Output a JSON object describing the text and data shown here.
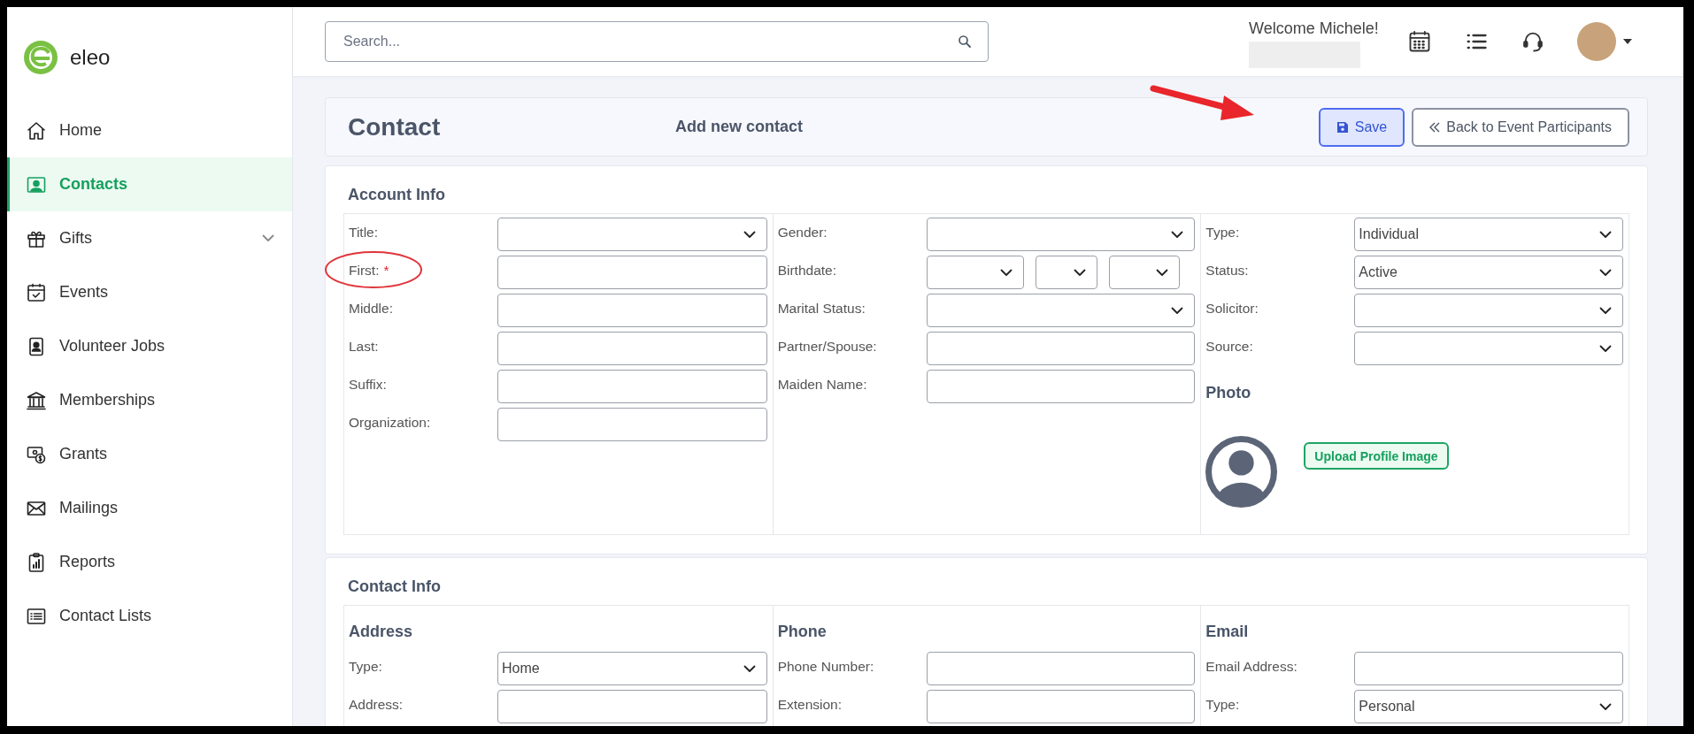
{
  "brand": {
    "name": "eleo"
  },
  "sidebar": {
    "items": [
      {
        "label": "Home",
        "selected": false,
        "has_submenu": false
      },
      {
        "label": "Contacts",
        "selected": true,
        "has_submenu": false
      },
      {
        "label": "Gifts",
        "selected": false,
        "has_submenu": true
      },
      {
        "label": "Events",
        "selected": false,
        "has_submenu": false
      },
      {
        "label": "Volunteer Jobs",
        "selected": false,
        "has_submenu": false
      },
      {
        "label": "Memberships",
        "selected": false,
        "has_submenu": false
      },
      {
        "label": "Grants",
        "selected": false,
        "has_submenu": false
      },
      {
        "label": "Mailings",
        "selected": false,
        "has_submenu": false
      },
      {
        "label": "Reports",
        "selected": false,
        "has_submenu": false
      },
      {
        "label": "Contact Lists",
        "selected": false,
        "has_submenu": false
      }
    ]
  },
  "header": {
    "search": {
      "placeholder": "Search..."
    },
    "welcome": "Welcome Michele!"
  },
  "page_header": {
    "title": "Contact",
    "subtitle": "Add new contact",
    "save_button": "Save",
    "back_button": "Back to Event Participants",
    "annotation_arrow": true
  },
  "account_info": {
    "heading": "Account Info",
    "columns": [
      {
        "fields": [
          {
            "label": "Title:",
            "kind": "select",
            "circled": false
          },
          {
            "label": "First:",
            "kind": "input",
            "required_mark": "*",
            "circled": true
          },
          {
            "label": "Middle:",
            "kind": "input",
            "circled": false
          },
          {
            "label": "Last:",
            "kind": "input",
            "circled": false
          },
          {
            "label": "Suffix:",
            "kind": "input",
            "circled": false
          },
          {
            "label": "Organization:",
            "kind": "input",
            "circled": false
          }
        ]
      },
      {
        "fields": [
          {
            "label": "Gender:",
            "kind": "select",
            "circled": false
          },
          {
            "label": "Birthdate:",
            "kind": "date",
            "circled": false
          },
          {
            "label": "Marital Status:",
            "kind": "select",
            "circled": false
          },
          {
            "label": "Partner/Spouse:",
            "kind": "input",
            "circled": false
          },
          {
            "label": "Maiden Name:",
            "kind": "input",
            "circled": false
          }
        ]
      },
      {
        "fields": [
          {
            "label": "Type:",
            "kind": "select",
            "value": "Individual",
            "circled": false
          },
          {
            "label": "Status:",
            "kind": "select",
            "value": "Active",
            "circled": false
          },
          {
            "label": "Solicitor:",
            "kind": "select",
            "circled": false
          },
          {
            "label": "Source:",
            "kind": "select",
            "circled": false
          }
        ],
        "photo": {
          "heading": "Photo",
          "upload_button": "Upload Profile Image"
        }
      }
    ]
  },
  "contact_info": {
    "heading": "Contact Info",
    "columns": [
      {
        "heading": "Address",
        "fields": [
          {
            "label": "Type:",
            "kind": "select",
            "value": "Home",
            "circled": false
          },
          {
            "label": "Address:",
            "kind": "input",
            "circled": false
          }
        ]
      },
      {
        "heading": "Phone",
        "fields": [
          {
            "label": "Phone Number:",
            "kind": "input",
            "circled": false
          },
          {
            "label": "Extension:",
            "kind": "input",
            "circled": false
          }
        ]
      },
      {
        "heading": "Email",
        "fields": [
          {
            "label": "Email Address:",
            "kind": "input",
            "circled": false
          },
          {
            "label": "Type:",
            "kind": "select",
            "value": "Personal",
            "circled": false
          }
        ]
      }
    ]
  }
}
